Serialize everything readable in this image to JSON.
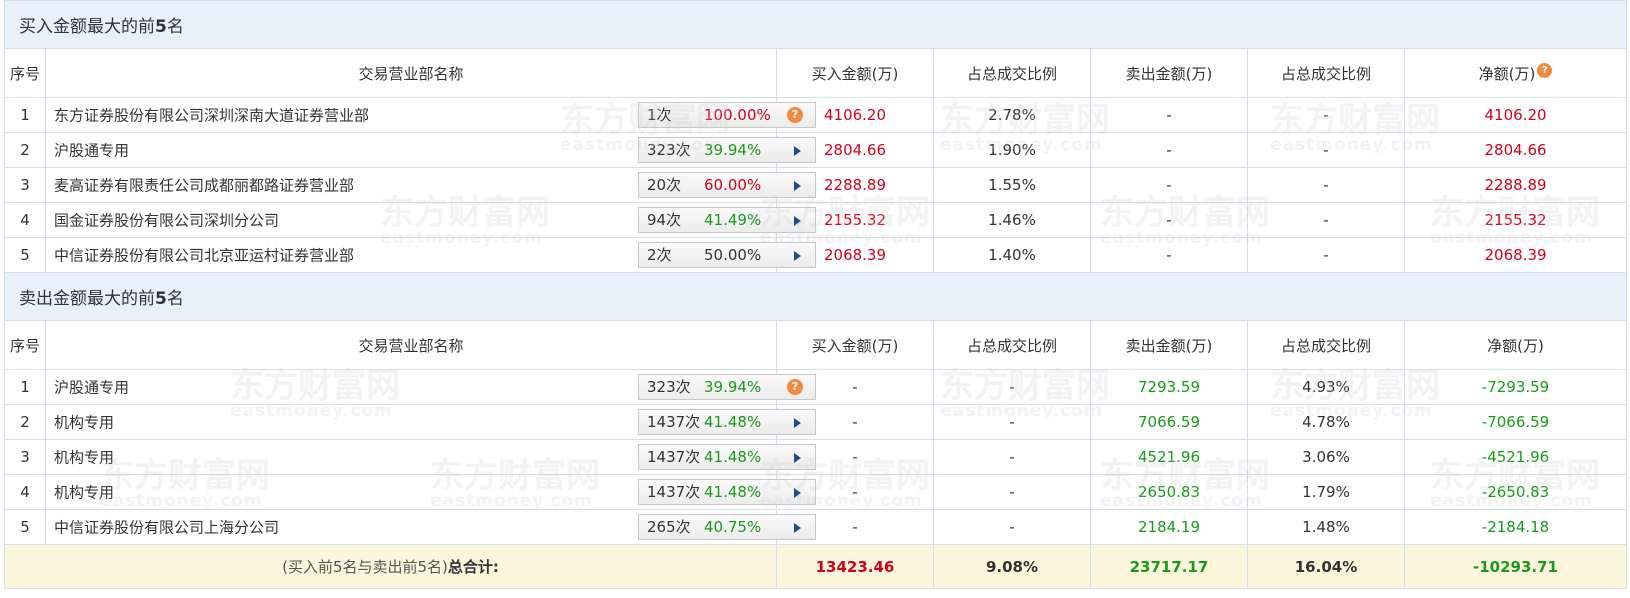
{
  "buy_section": {
    "title_prefix": "买入金额最大的前",
    "title_num": "5",
    "title_suffix": "名",
    "headers": {
      "idx": "序号",
      "name": "交易营业部名称",
      "buy": "买入金额(万)",
      "buy_ratio": "占总成交比例",
      "sell": "卖出金额(万)",
      "sell_ratio": "占总成交比例",
      "net": "净额(万)"
    },
    "rows": [
      {
        "idx": "1",
        "name": "东方证券股份有限公司深圳深南大道证券营业部",
        "count": "1次",
        "pct": "100.00%",
        "pct_color": "red",
        "icon": "question-icon",
        "buy": "4106.20",
        "buy_ratio": "2.78%",
        "sell": "-",
        "sell_ratio": "-",
        "net": "4106.20"
      },
      {
        "idx": "2",
        "name": "沪股通专用",
        "count": "323次",
        "pct": "39.94%",
        "pct_color": "green",
        "icon": "arrow-right-icon",
        "buy": "2804.66",
        "buy_ratio": "1.90%",
        "sell": "-",
        "sell_ratio": "-",
        "net": "2804.66"
      },
      {
        "idx": "3",
        "name": "麦高证券有限责任公司成都丽都路证券营业部",
        "count": "20次",
        "pct": "60.00%",
        "pct_color": "red",
        "icon": "arrow-right-icon",
        "buy": "2288.89",
        "buy_ratio": "1.55%",
        "sell": "-",
        "sell_ratio": "-",
        "net": "2288.89"
      },
      {
        "idx": "4",
        "name": "国金证券股份有限公司深圳分公司",
        "count": "94次",
        "pct": "41.49%",
        "pct_color": "green",
        "icon": "arrow-right-icon",
        "buy": "2155.32",
        "buy_ratio": "1.46%",
        "sell": "-",
        "sell_ratio": "-",
        "net": "2155.32"
      },
      {
        "idx": "5",
        "name": "中信证券股份有限公司北京亚运村证券营业部",
        "count": "2次",
        "pct": "50.00%",
        "pct_color": "normal",
        "icon": "arrow-right-icon",
        "buy": "2068.39",
        "buy_ratio": "1.40%",
        "sell": "-",
        "sell_ratio": "-",
        "net": "2068.39"
      }
    ]
  },
  "sell_section": {
    "title_prefix": "卖出金额最大的前",
    "title_num": "5",
    "title_suffix": "名",
    "headers": {
      "idx": "序号",
      "name": "交易营业部名称",
      "buy": "买入金额(万)",
      "buy_ratio": "占总成交比例",
      "sell": "卖出金额(万)",
      "sell_ratio": "占总成交比例",
      "net": "净额(万)"
    },
    "rows": [
      {
        "idx": "1",
        "name": "沪股通专用",
        "count": "323次",
        "pct": "39.94%",
        "pct_color": "green",
        "icon": "question-icon",
        "buy": "-",
        "buy_ratio": "-",
        "sell": "7293.59",
        "sell_ratio": "4.93%",
        "net": "-7293.59"
      },
      {
        "idx": "2",
        "name": "机构专用",
        "count": "1437次",
        "pct": "41.48%",
        "pct_color": "green",
        "icon": "arrow-right-icon",
        "buy": "-",
        "buy_ratio": "-",
        "sell": "7066.59",
        "sell_ratio": "4.78%",
        "net": "-7066.59"
      },
      {
        "idx": "3",
        "name": "机构专用",
        "count": "1437次",
        "pct": "41.48%",
        "pct_color": "green",
        "icon": "arrow-right-icon",
        "buy": "-",
        "buy_ratio": "-",
        "sell": "4521.96",
        "sell_ratio": "3.06%",
        "net": "-4521.96"
      },
      {
        "idx": "4",
        "name": "机构专用",
        "count": "1437次",
        "pct": "41.48%",
        "pct_color": "green",
        "icon": "arrow-right-icon",
        "buy": "-",
        "buy_ratio": "-",
        "sell": "2650.83",
        "sell_ratio": "1.79%",
        "net": "-2650.83"
      },
      {
        "idx": "5",
        "name": "中信证券股份有限公司上海分公司",
        "count": "265次",
        "pct": "40.75%",
        "pct_color": "green",
        "icon": "arrow-right-icon",
        "buy": "-",
        "buy_ratio": "-",
        "sell": "2184.19",
        "sell_ratio": "1.48%",
        "net": "-2184.18"
      }
    ]
  },
  "total": {
    "label_prefix": "(买入前5名与卖出前5名)",
    "label_bold": "总合计:",
    "buy": "13423.46",
    "buy_ratio": "9.08%",
    "sell": "23717.17",
    "sell_ratio": "16.04%",
    "net": "-10293.71"
  },
  "watermark": {
    "cn": "东方财富网",
    "en": "eastmoney.com"
  },
  "colors": {
    "red": "#d0021b",
    "green": "#1a9a1a",
    "header_bg": "#e8f1fa",
    "total_bg": "#fbf6dc",
    "border": "#cfe0ee"
  }
}
